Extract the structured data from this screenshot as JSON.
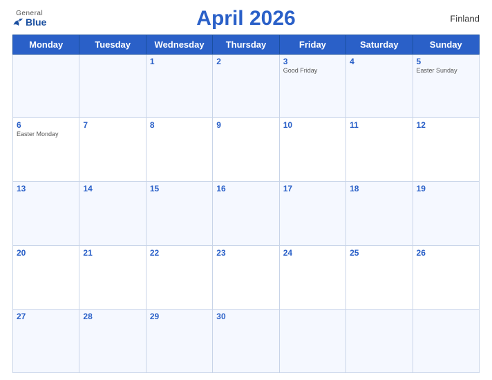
{
  "header": {
    "title": "April 2026",
    "country": "Finland",
    "logo": {
      "general": "General",
      "blue": "Blue"
    }
  },
  "weekdays": [
    "Monday",
    "Tuesday",
    "Wednesday",
    "Thursday",
    "Friday",
    "Saturday",
    "Sunday"
  ],
  "weeks": [
    [
      {
        "day": "",
        "holiday": ""
      },
      {
        "day": "",
        "holiday": ""
      },
      {
        "day": "1",
        "holiday": ""
      },
      {
        "day": "2",
        "holiday": ""
      },
      {
        "day": "3",
        "holiday": "Good Friday"
      },
      {
        "day": "4",
        "holiday": ""
      },
      {
        "day": "5",
        "holiday": "Easter Sunday"
      }
    ],
    [
      {
        "day": "6",
        "holiday": "Easter Monday"
      },
      {
        "day": "7",
        "holiday": ""
      },
      {
        "day": "8",
        "holiday": ""
      },
      {
        "day": "9",
        "holiday": ""
      },
      {
        "day": "10",
        "holiday": ""
      },
      {
        "day": "11",
        "holiday": ""
      },
      {
        "day": "12",
        "holiday": ""
      }
    ],
    [
      {
        "day": "13",
        "holiday": ""
      },
      {
        "day": "14",
        "holiday": ""
      },
      {
        "day": "15",
        "holiday": ""
      },
      {
        "day": "16",
        "holiday": ""
      },
      {
        "day": "17",
        "holiday": ""
      },
      {
        "day": "18",
        "holiday": ""
      },
      {
        "day": "19",
        "holiday": ""
      }
    ],
    [
      {
        "day": "20",
        "holiday": ""
      },
      {
        "day": "21",
        "holiday": ""
      },
      {
        "day": "22",
        "holiday": ""
      },
      {
        "day": "23",
        "holiday": ""
      },
      {
        "day": "24",
        "holiday": ""
      },
      {
        "day": "25",
        "holiday": ""
      },
      {
        "day": "26",
        "holiday": ""
      }
    ],
    [
      {
        "day": "27",
        "holiday": ""
      },
      {
        "day": "28",
        "holiday": ""
      },
      {
        "day": "29",
        "holiday": ""
      },
      {
        "day": "30",
        "holiday": ""
      },
      {
        "day": "",
        "holiday": ""
      },
      {
        "day": "",
        "holiday": ""
      },
      {
        "day": "",
        "holiday": ""
      }
    ]
  ]
}
